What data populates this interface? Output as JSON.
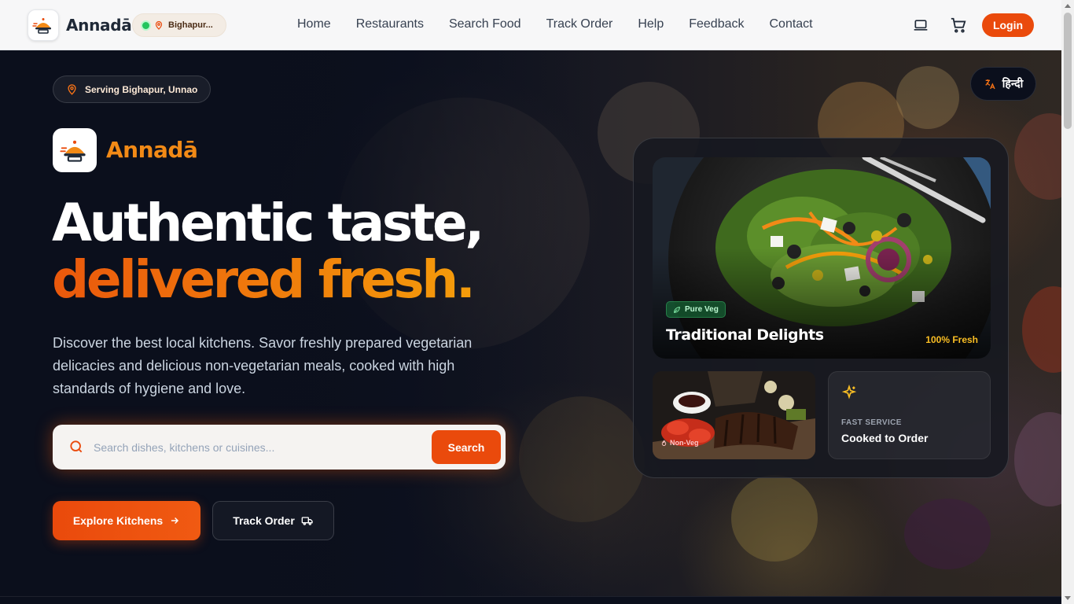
{
  "nav": {
    "brand": "Annadā",
    "location": "Bighapur...",
    "links": [
      "Home",
      "Restaurants",
      "Search Food",
      "Track Order",
      "Help",
      "Feedback",
      "Contact"
    ],
    "login_label": "Login"
  },
  "hero": {
    "serving": "Serving Bighapur, Unnao",
    "lang_label": "हिन्दी",
    "brand": "Annadā",
    "headline_line1": "Authentic taste,",
    "headline_line2": "delivered fresh.",
    "description": "Discover the best local kitchens. Savor freshly prepared vegetarian delicacies and delicious non-vegetarian meals, cooked with high standards of hygiene and love.",
    "search": {
      "placeholder": "Search dishes, kitchens or cuisines...",
      "button_label": "Search"
    },
    "explore_label": "Explore Kitchens",
    "track_label": "Track Order"
  },
  "showcase": {
    "feature_tag": "Pure Veg",
    "feature_title": "Traditional Delights",
    "feature_badge": "100% Fresh",
    "nonveg_tag": "Non-Veg",
    "fast_subtitle": "FAST SERVICE",
    "fast_title": "Cooked to Order"
  },
  "colors": {
    "accent": "#ea4a0c",
    "brand_gold": "#f28a16",
    "hero_bg": "#0b0f1c"
  },
  "icons": [
    "app-logo-icon",
    "map-pin-icon",
    "laptop-icon",
    "cart-icon",
    "translate-icon",
    "search-icon",
    "arrow-right-icon",
    "truck-icon",
    "leaf-icon",
    "flame-icon",
    "sparkles-icon"
  ]
}
